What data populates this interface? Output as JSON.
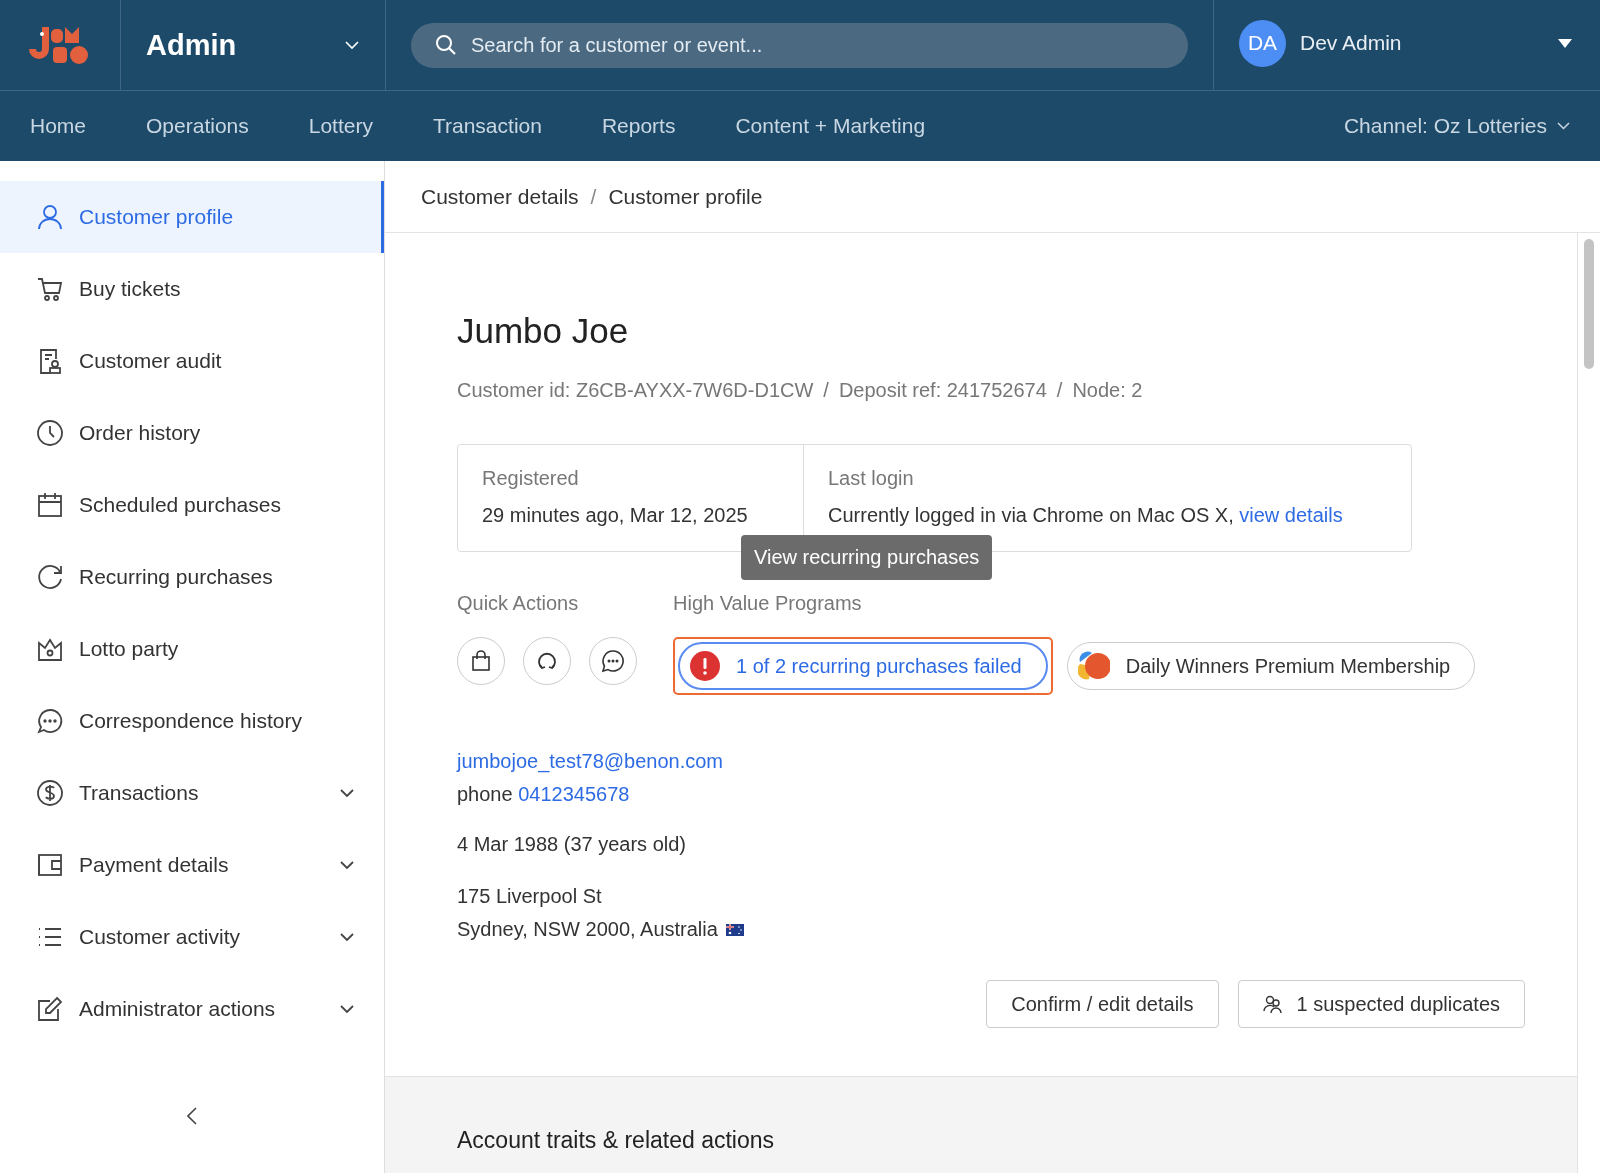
{
  "header": {
    "app_title": "Admin",
    "search": {
      "placeholder": "Search for a customer or event..."
    },
    "user": {
      "initials": "DA",
      "name": "Dev Admin"
    }
  },
  "nav": {
    "items": [
      "Home",
      "Operations",
      "Lottery",
      "Transaction",
      "Reports",
      "Content + Marketing"
    ],
    "channel": "Channel: Oz Lotteries"
  },
  "sidebar": {
    "items": [
      {
        "label": "Customer profile",
        "selected": true
      },
      {
        "label": "Buy tickets",
        "selected": false
      },
      {
        "label": "Customer audit",
        "selected": false
      },
      {
        "label": "Order history",
        "selected": false
      },
      {
        "label": "Scheduled purchases",
        "selected": false
      },
      {
        "label": "Recurring purchases",
        "selected": false
      },
      {
        "label": "Lotto party",
        "selected": false
      },
      {
        "label": "Correspondence history",
        "selected": false
      },
      {
        "label": "Transactions",
        "selected": false,
        "expanded": false
      },
      {
        "label": "Payment details",
        "selected": false,
        "expanded": false
      },
      {
        "label": "Customer activity",
        "selected": false,
        "expanded": false
      },
      {
        "label": "Administrator actions",
        "selected": false,
        "expanded": false
      }
    ]
  },
  "breadcrumb": [
    "Customer details",
    "/",
    "Customer profile"
  ],
  "customer": {
    "name": "Jumbo Joe",
    "ids": [
      "Customer id: Z6CB-AYXX-7W6D-D1CW",
      "/",
      "Deposit ref: 241752674",
      "/",
      "Node: 2"
    ],
    "registered": {
      "label": "Registered",
      "value": "29 minutes ago, Mar 12, 2025"
    },
    "last_login": {
      "label": "Last login",
      "value": "Currently logged in via Chrome on Mac OS X,",
      "link": "view details"
    },
    "quick_actions_label": "Quick Actions",
    "programs_label": "High Value Programs",
    "alert": {
      "text": "1 of 2 recurring purchases failed",
      "tooltip": "View recurring purchases",
      "focused": true
    },
    "membership": "Daily Winners Premium Membership",
    "email": "jumbojoe_test78@benon.com",
    "phone_label": "phone",
    "phone": "0412345678",
    "dob": "4 Mar 1988 (37 years old)",
    "address": [
      "175 Liverpool St",
      "Sydney, NSW 2000, Australia"
    ],
    "buttons": [
      "Confirm / edit details",
      "1 suspected duplicates"
    ]
  },
  "section_title": "Account traits & related actions"
}
